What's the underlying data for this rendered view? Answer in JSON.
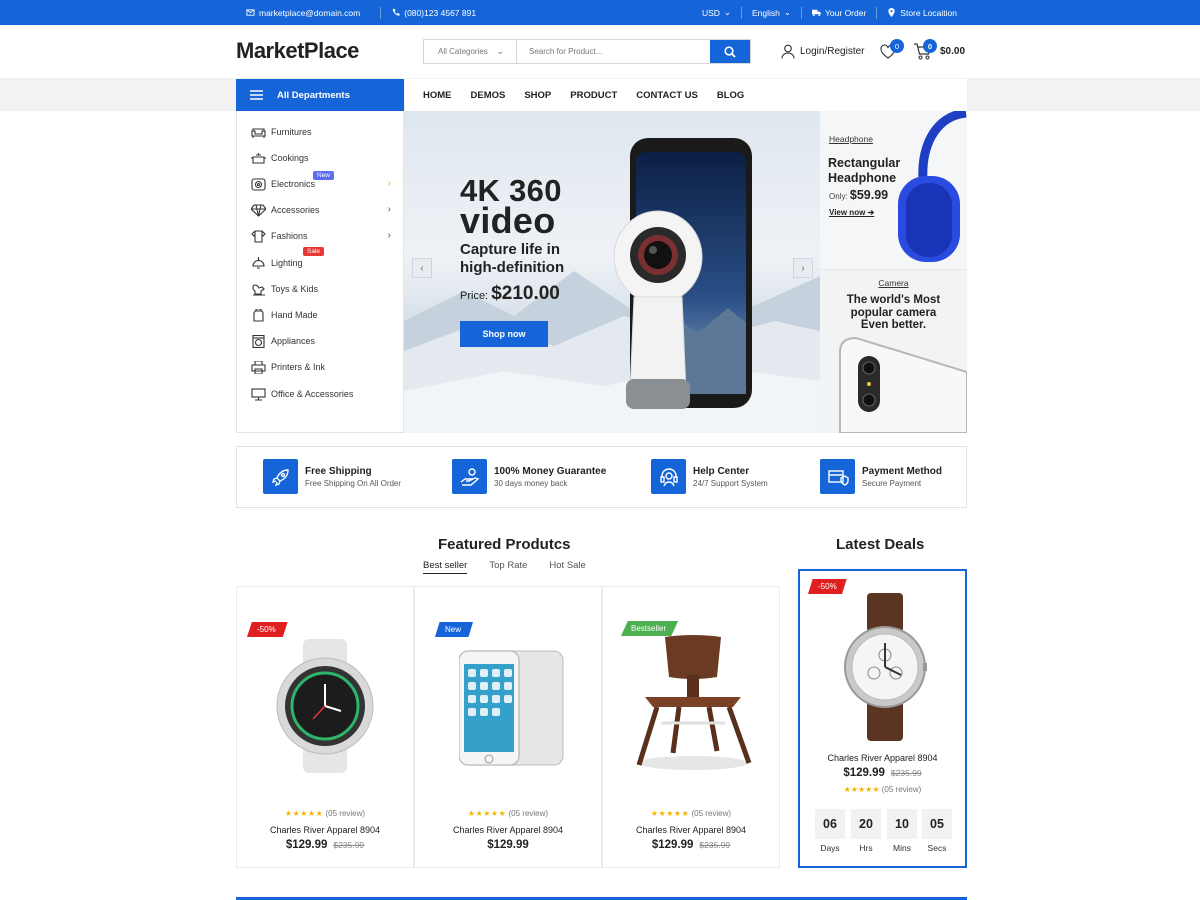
{
  "topbar": {
    "email": "marketplace@domain.com",
    "phone": "(080)123 4567 891",
    "currency": "USD",
    "language": "English",
    "your_order": "Your Order",
    "store_location": "Store Locaition"
  },
  "header": {
    "logo": "MarketPlace",
    "category_select": "All Categories",
    "search_placeholder": "Search for Product...",
    "login": "Login/Register",
    "wishlist_count": "0",
    "cart_count": "0",
    "cart_total": "$0.00"
  },
  "nav": {
    "all_departments": "All Departments",
    "menu": [
      "HOME",
      "DEMOS",
      "SHOP",
      "PRODUCT",
      "CONTACT US",
      "BLOG"
    ]
  },
  "sidebar": {
    "items": [
      {
        "label": "Furnitures",
        "icon": "sofa-icon"
      },
      {
        "label": "Cookings",
        "icon": "pot-icon"
      },
      {
        "label": "Electronics",
        "icon": "camera-icon",
        "tag": "New",
        "arrow": "›"
      },
      {
        "label": "Accessories",
        "icon": "diamond-icon",
        "arrow": "›"
      },
      {
        "label": "Fashions",
        "icon": "shirt-icon",
        "arrow": "›"
      },
      {
        "label": "Lighting",
        "icon": "lamp-icon",
        "tag": "Sale"
      },
      {
        "label": "Toys & Kids",
        "icon": "horse-icon"
      },
      {
        "label": "Hand Made",
        "icon": "jar-icon"
      },
      {
        "label": "Appliances",
        "icon": "washer-icon"
      },
      {
        "label": "Printers & Ink",
        "icon": "printer-icon"
      },
      {
        "label": "Office & Accessories",
        "icon": "board-icon"
      }
    ]
  },
  "hero": {
    "title_line1": "4K 360",
    "title_line2": "video",
    "subtitle_line1": "Capture life in",
    "subtitle_line2": "high-definition",
    "price_label": "Price:",
    "price": "$210.00",
    "button": "Shop now"
  },
  "banner_headphone": {
    "category": "Headphone",
    "title_line1": "Rectangular",
    "title_line2": "Headphone",
    "only_label": "Only:",
    "price": "$59.99",
    "link": "View now"
  },
  "banner_camera": {
    "category": "Camera",
    "line1": "The world's Most",
    "line2": "popular camera",
    "line3": "Even better."
  },
  "features": [
    {
      "title": "Free Shipping",
      "sub": "Free Shipping On All Order",
      "icon": "rocket-icon"
    },
    {
      "title": "100% Money Guarantee",
      "sub": "30 days money back",
      "icon": "money-hand-icon"
    },
    {
      "title": "Help Center",
      "sub": "24/7 Support System",
      "icon": "headset-icon"
    },
    {
      "title": "Payment Method",
      "sub": "Secure Payment",
      "icon": "secure-card-icon"
    }
  ],
  "featured": {
    "title": "Featured Produtcs",
    "tabs": [
      "Best seller",
      "Top Rate",
      "Hot Sale"
    ],
    "products": [
      {
        "label": "-50%",
        "label_color": "#e02020",
        "name": "Charles River Apparel 8904",
        "price": "$129.99",
        "old_price": "$235.99",
        "reviews": "(05 review)",
        "stars": "★★★★★"
      },
      {
        "label": "New",
        "label_color": "#1565d8",
        "name": "Charles River Apparel 8904",
        "price": "$129.99",
        "old_price": "",
        "reviews": "(05 review)",
        "stars": "★★★★★"
      },
      {
        "label": "Bestseller",
        "label_color": "#4caf50",
        "name": "Charles River Apparel 8904",
        "price": "$129.99",
        "old_price": "$235.99",
        "reviews": "(05 review)",
        "stars": "★★★★★"
      }
    ]
  },
  "deals": {
    "title": "Latest Deals",
    "label": "-50%",
    "name": "Charles River Apparel 8904",
    "price": "$129.99",
    "old_price": "$235.99",
    "stars": "★★★★★",
    "reviews": "(05 review)",
    "countdown": [
      {
        "value": "06",
        "unit": "Days"
      },
      {
        "value": "20",
        "unit": "Hrs"
      },
      {
        "value": "10",
        "unit": "Mins"
      },
      {
        "value": "05",
        "unit": "Secs"
      }
    ]
  },
  "colors": {
    "accent": "#1565d8",
    "sale": "#e02020",
    "bestseller": "#4caf50",
    "star": "#f5b400"
  }
}
